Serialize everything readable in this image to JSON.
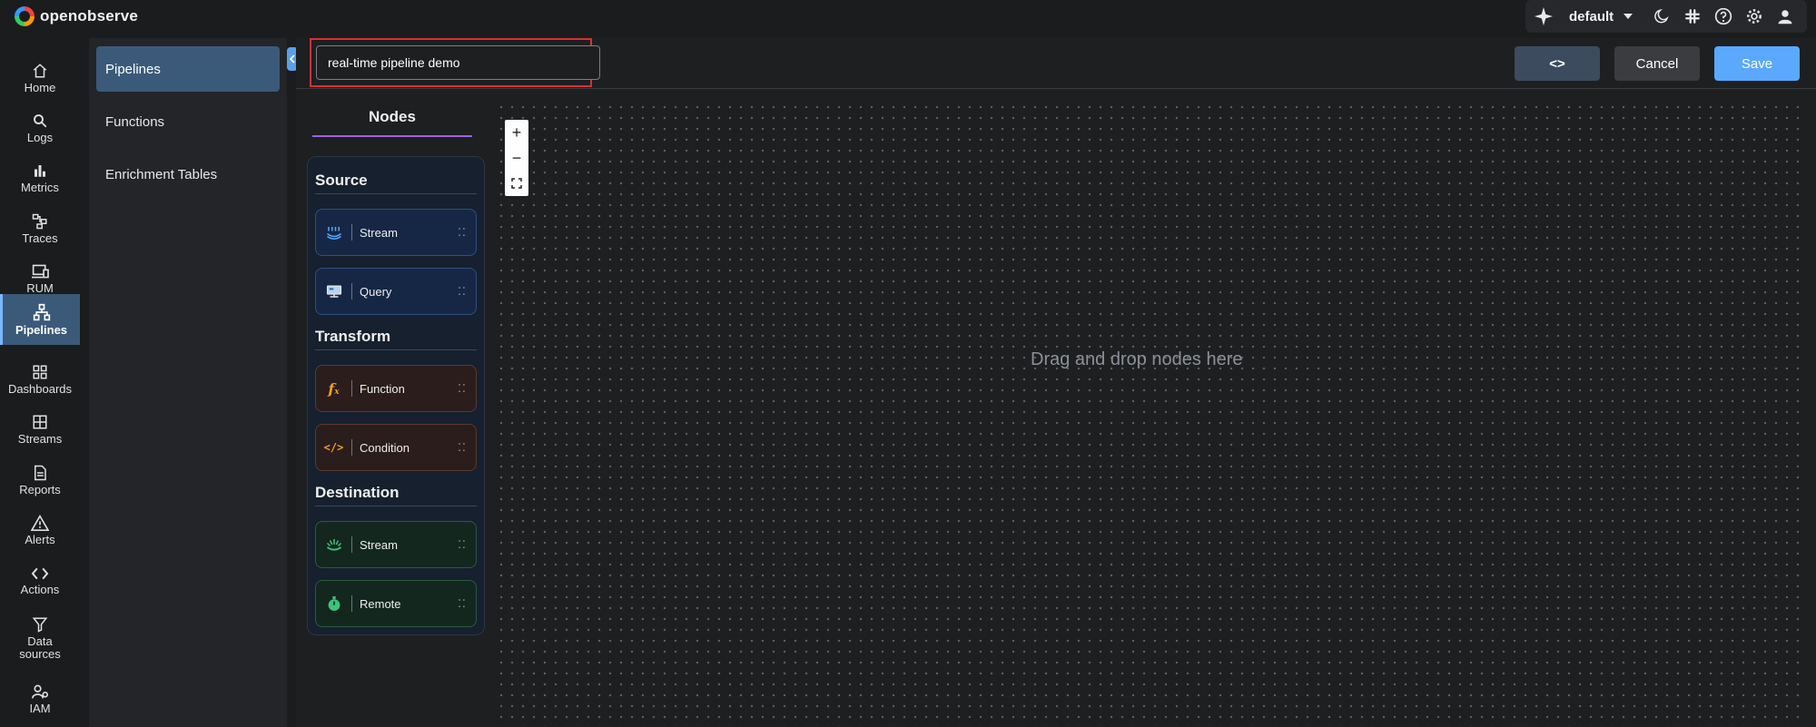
{
  "app": {
    "logo_text": "openobserve"
  },
  "top_right": {
    "org": "default",
    "icons": [
      "sparkle-icon",
      "chevron-down-icon",
      "moon-icon",
      "slack-icon",
      "help-icon",
      "gear-icon",
      "user-icon"
    ]
  },
  "leftnav": {
    "items": [
      {
        "label": "Home",
        "icon": "home-icon"
      },
      {
        "label": "Logs",
        "icon": "search-icon"
      },
      {
        "label": "Metrics",
        "icon": "bar-chart-icon"
      },
      {
        "label": "Traces",
        "icon": "traces-icon"
      },
      {
        "label": "RUM",
        "icon": "monitor-icon"
      },
      {
        "label": "Pipelines",
        "icon": "pipelines-icon",
        "active": true
      },
      {
        "label": "Dashboards",
        "icon": "dashboards-icon"
      },
      {
        "label": "Streams",
        "icon": "grid-icon"
      },
      {
        "label": "Reports",
        "icon": "report-icon"
      },
      {
        "label": "Alerts",
        "icon": "alert-icon"
      },
      {
        "label": "Actions",
        "icon": "code-icon"
      },
      {
        "label": "Data sources",
        "icon": "filter-icon"
      },
      {
        "label": "IAM",
        "icon": "iam-icon"
      }
    ]
  },
  "subnav": {
    "items": [
      {
        "label": "Pipelines",
        "active": true
      },
      {
        "label": "Functions"
      },
      {
        "label": "Enrichment Tables"
      }
    ]
  },
  "header": {
    "pipeline_name": "real-time pipeline demo",
    "code_label": "<>",
    "cancel_label": "Cancel",
    "save_label": "Save"
  },
  "palette": {
    "tab_label": "Nodes",
    "groups": [
      {
        "title": "Source",
        "nodes": [
          {
            "label": "Stream",
            "icon": "stream-source-icon"
          },
          {
            "label": "Query",
            "icon": "query-icon"
          }
        ]
      },
      {
        "title": "Transform",
        "nodes": [
          {
            "label": "Function",
            "icon": "function-icon"
          },
          {
            "label": "Condition",
            "icon": "condition-icon"
          }
        ]
      },
      {
        "title": "Destination",
        "nodes": [
          {
            "label": "Stream",
            "icon": "stream-destination-icon"
          },
          {
            "label": "Remote",
            "icon": "remote-icon"
          }
        ]
      }
    ]
  },
  "canvas": {
    "drop_hint": "Drag and drop nodes here",
    "zoom_in": "+",
    "zoom_out": "−"
  },
  "colors": {
    "accent": "#5aa9ff",
    "active_nav": "#3b5a7a",
    "highlight_border": "#d93030",
    "nodes_tab_underline": "#a060e0"
  }
}
